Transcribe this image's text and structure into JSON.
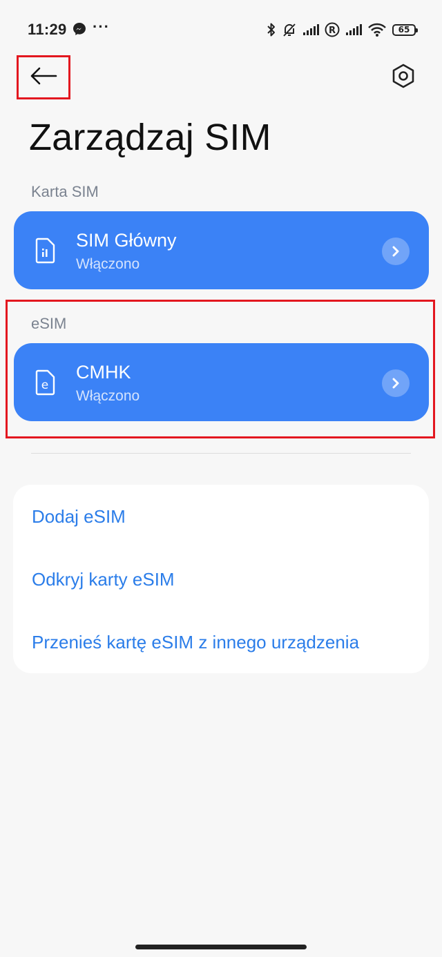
{
  "status_bar": {
    "time": "11:29",
    "more": "···",
    "battery": "65",
    "icons": [
      "messenger-icon",
      "bluetooth-icon",
      "bell-off-icon",
      "signal-icon",
      "roaming-r-icon",
      "signal-icon",
      "wifi-icon",
      "battery-icon"
    ]
  },
  "header": {
    "back_icon": "arrow-left-icon",
    "settings_icon": "hexagon-settings-icon",
    "title": "Zarządzaj SIM"
  },
  "sim_section": {
    "label": "Karta SIM",
    "card": {
      "name": "SIM Główny",
      "status": "Włączono",
      "icon": "sim-card-icon"
    }
  },
  "esim_section": {
    "label": "eSIM",
    "card": {
      "name": "CMHK",
      "status": "Włączono",
      "icon": "esim-icon"
    }
  },
  "actions": [
    {
      "label": "Dodaj eSIM"
    },
    {
      "label": "Odkryj karty eSIM"
    },
    {
      "label": "Przenieś kartę eSIM z innego urządzenia"
    }
  ],
  "colors": {
    "accent": "#3b82f6",
    "link": "#2b7de9",
    "highlight": "#e3171f",
    "background": "#f7f7f7"
  }
}
